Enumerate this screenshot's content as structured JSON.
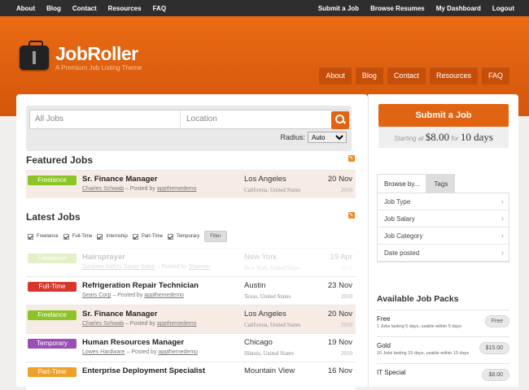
{
  "topnav": {
    "left": [
      "About",
      "Blog",
      "Contact",
      "Resources",
      "FAQ"
    ],
    "right": [
      "Submit a Job",
      "Browse Resumes",
      "My Dashboard",
      "Logout"
    ]
  },
  "brand": {
    "name": "JobRoller",
    "tagline": "A Premium Job Listing Theme"
  },
  "header_nav": [
    "About",
    "Blog",
    "Contact",
    "Resources",
    "FAQ"
  ],
  "search": {
    "keyword_placeholder": "All Jobs",
    "location_placeholder": "Location",
    "radius_label": "Radius:",
    "radius_value": "Auto"
  },
  "featured": {
    "title": "Featured Jobs",
    "jobs": [
      {
        "type": "Freelance",
        "title": "Sr. Finance Manager",
        "company": "Charles Schwab",
        "posted_prefix": "– Posted by",
        "poster": "appthemedemo",
        "city": "Los Angeles",
        "region": "California, United States",
        "date": "20 Nov",
        "year": "2010"
      }
    ]
  },
  "latest": {
    "title": "Latest Jobs",
    "filters": [
      "Freelance",
      "Full-Time",
      "Internship",
      "Part-Time",
      "Temporary"
    ],
    "filter_button": "Filter",
    "jobs": [
      {
        "type": "Freelance",
        "title": "Hairsprayer",
        "company": "Sunblow Sally's Sassy Salon",
        "posted_prefix": "– Posted by",
        "poster": "Sharnon",
        "city": "New York",
        "region": "New York, United States",
        "date": "19 Apr",
        "year": "2013"
      },
      {
        "type": "Full-Time",
        "title": "Refrigeration Repair Technician",
        "company": "Sears Corp",
        "posted_prefix": "– Posted by",
        "poster": "appthemedemo",
        "city": "Austin",
        "region": "Texas, United States",
        "date": "23 Nov",
        "year": "2010"
      },
      {
        "type": "Freelance",
        "title": "Sr. Finance Manager",
        "company": "Charles Schwab",
        "posted_prefix": "– Posted by",
        "poster": "appthemedemo",
        "city": "Los Angeles",
        "region": "California, United States",
        "date": "20 Nov",
        "year": "2010"
      },
      {
        "type": "Temporary",
        "title": "Human Resources Manager",
        "company": "Lowes Hardware",
        "posted_prefix": "– Posted by",
        "poster": "appthemedemo",
        "city": "Chicago",
        "region": "Illinois, United States",
        "date": "19 Nov",
        "year": "2010"
      },
      {
        "type": "Part-Time",
        "title": "Enterprise Deployment Specialist",
        "company": "",
        "posted_prefix": "",
        "poster": "",
        "city": "Mountain View",
        "region": "",
        "date": "16 Nov",
        "year": ""
      }
    ]
  },
  "sidebar": {
    "submit_label": "Submit a Job",
    "price_prefix": "Starting at",
    "price_amount": "$8.00",
    "price_for": "for",
    "price_duration": "10 days",
    "tabs": [
      "Browse by...",
      "Tags"
    ],
    "browse_items": [
      "Job Type",
      "Job Salary",
      "Job Category",
      "Date posted"
    ],
    "packs_title": "Available Job Packs",
    "packs": [
      {
        "name": "Free",
        "desc": "1 Jobs lasting 5 days, usable within 5 days",
        "price": "Free"
      },
      {
        "name": "Gold",
        "desc": "10 Jobs lasting 15 days, usable within 15 days",
        "price": "$15.00"
      },
      {
        "name": "IT Special",
        "desc": "",
        "price": "$8.00"
      }
    ]
  },
  "colors": {
    "accent": "#e16412",
    "freelance": "#8bc424",
    "fulltime": "#d8352b",
    "temporary": "#9b4eb4",
    "parttime": "#f0a02a"
  }
}
